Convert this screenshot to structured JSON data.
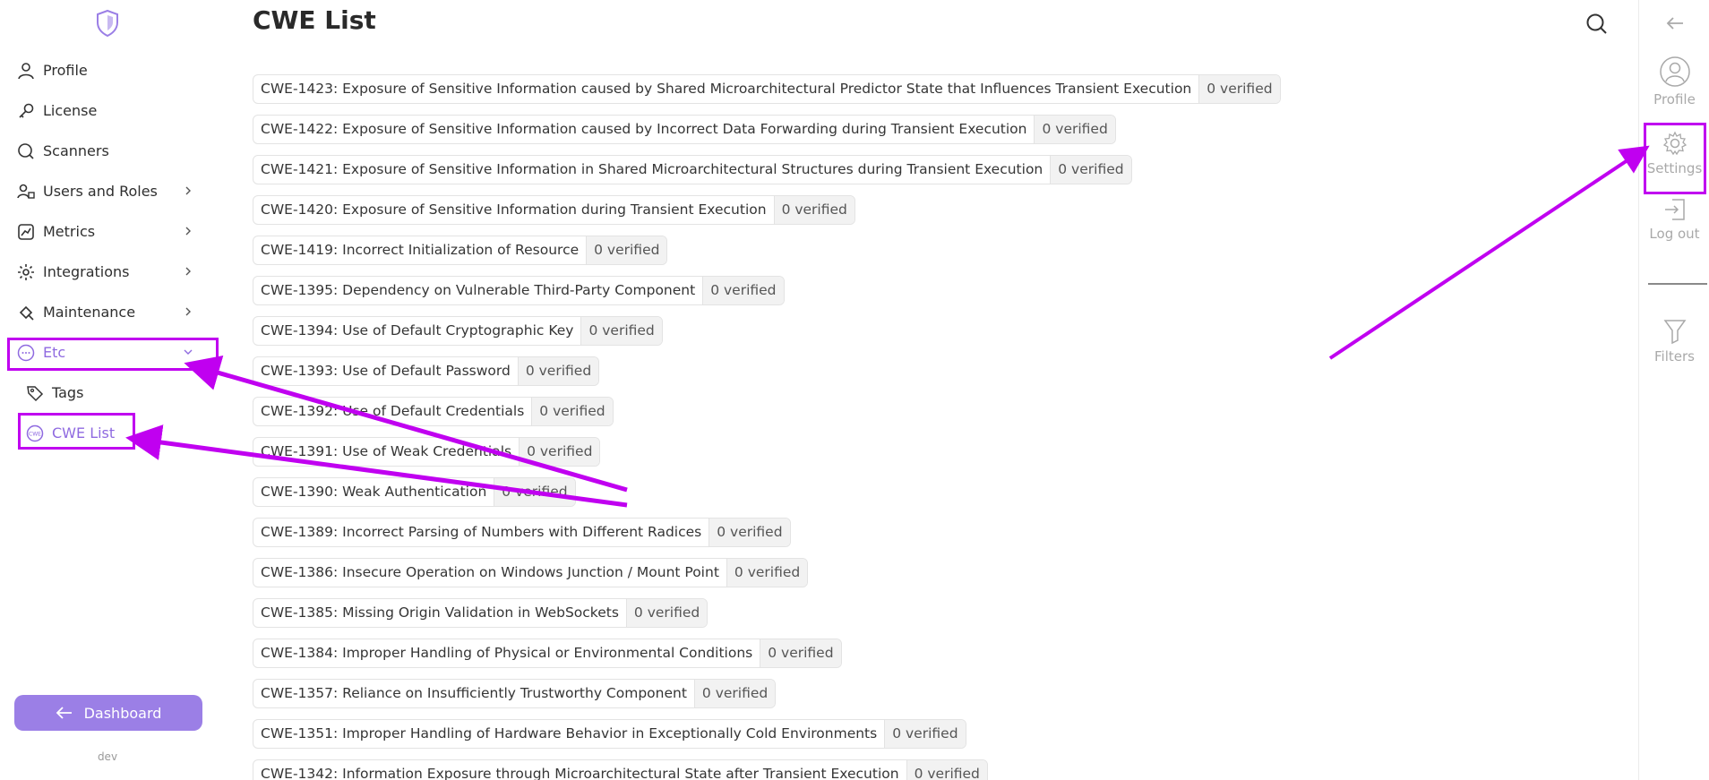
{
  "sidebar": {
    "items": [
      {
        "label": "Profile",
        "icon": "user-icon"
      },
      {
        "label": "License",
        "icon": "key-icon"
      },
      {
        "label": "Scanners",
        "icon": "scanner-icon"
      },
      {
        "label": "Users and Roles",
        "icon": "users-roles-icon",
        "expandable": true
      },
      {
        "label": "Metrics",
        "icon": "metrics-icon",
        "expandable": true
      },
      {
        "label": "Integrations",
        "icon": "integrations-icon",
        "expandable": true
      },
      {
        "label": "Maintenance",
        "icon": "maintenance-icon",
        "expandable": true
      },
      {
        "label": "Etc",
        "icon": "more-icon",
        "expanded": true
      },
      {
        "label": "Tags",
        "icon": "tag-icon"
      },
      {
        "label": "CWE List",
        "icon": "cwe-icon",
        "active": true
      }
    ],
    "dashboard_button": "Dashboard",
    "env": "dev"
  },
  "main": {
    "title": "CWE List",
    "items": [
      {
        "name": "CWE-1423: Exposure of Sensitive Information caused by Shared Microarchitectural Predictor State that Influences Transient Execution",
        "badge": "0 verified"
      },
      {
        "name": "CWE-1422: Exposure of Sensitive Information caused by Incorrect Data Forwarding during Transient Execution",
        "badge": "0 verified"
      },
      {
        "name": "CWE-1421: Exposure of Sensitive Information in Shared Microarchitectural Structures during Transient Execution",
        "badge": "0 verified"
      },
      {
        "name": "CWE-1420: Exposure of Sensitive Information during Transient Execution",
        "badge": "0 verified"
      },
      {
        "name": "CWE-1419: Incorrect Initialization of Resource",
        "badge": "0 verified"
      },
      {
        "name": "CWE-1395: Dependency on Vulnerable Third-Party Component",
        "badge": "0 verified"
      },
      {
        "name": "CWE-1394: Use of Default Cryptographic Key",
        "badge": "0 verified"
      },
      {
        "name": "CWE-1393: Use of Default Password",
        "badge": "0 verified"
      },
      {
        "name": "CWE-1392: Use of Default Credentials",
        "badge": "0 verified"
      },
      {
        "name": "CWE-1391: Use of Weak Credentials",
        "badge": "0 verified"
      },
      {
        "name": "CWE-1390: Weak Authentication",
        "badge": "0 verified"
      },
      {
        "name": "CWE-1389: Incorrect Parsing of Numbers with Different Radices",
        "badge": "0 verified"
      },
      {
        "name": "CWE-1386: Insecure Operation on Windows Junction / Mount Point",
        "badge": "0 verified"
      },
      {
        "name": "CWE-1385: Missing Origin Validation in WebSockets",
        "badge": "0 verified"
      },
      {
        "name": "CWE-1384: Improper Handling of Physical or Environmental Conditions",
        "badge": "0 verified"
      },
      {
        "name": "CWE-1357: Reliance on Insufficiently Trustworthy Component",
        "badge": "0 verified"
      },
      {
        "name": "CWE-1351: Improper Handling of Hardware Behavior in Exceptionally Cold Environments",
        "badge": "0 verified"
      },
      {
        "name": "CWE-1342: Information Exposure through Microarchitectural State after Transient Execution",
        "badge": "0 verified"
      }
    ]
  },
  "rail": {
    "profile": "Profile",
    "settings": "Settings",
    "logout": "Log out",
    "filters": "Filters"
  },
  "colors": {
    "accent": "#9b7fe6",
    "active_text": "#8f6ae0",
    "annotation": "#c000f0"
  }
}
